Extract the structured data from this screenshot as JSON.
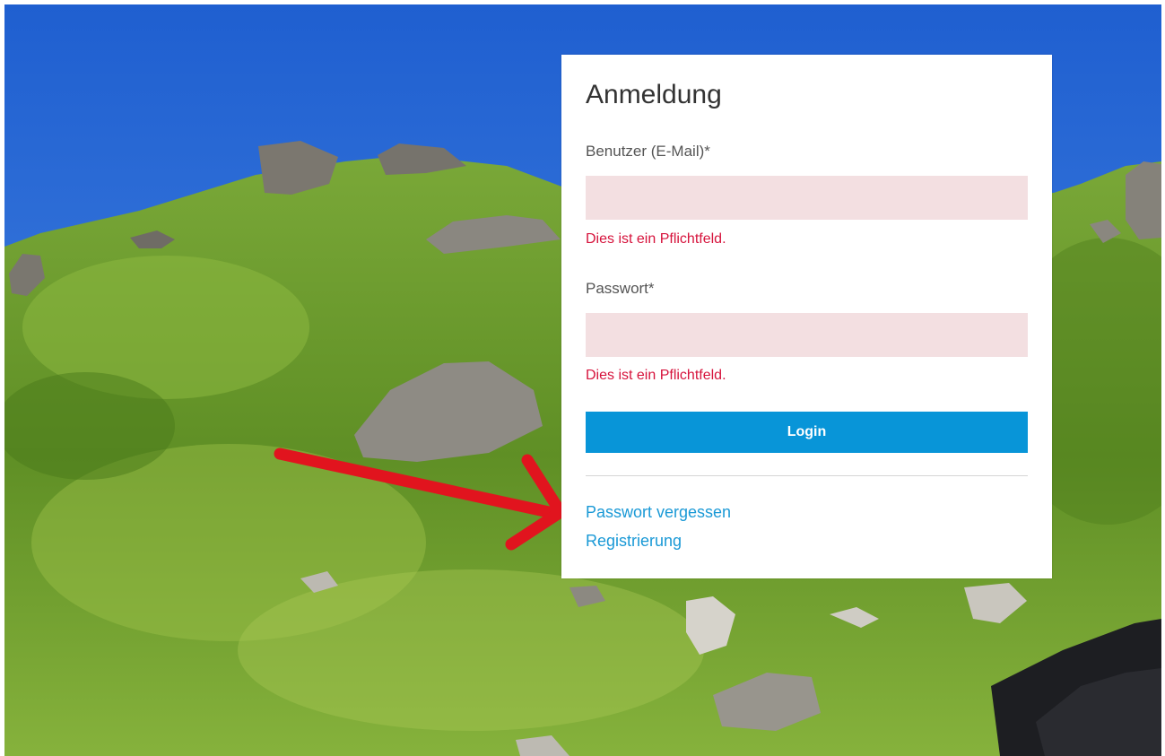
{
  "colors": {
    "sky": "#2d6fd8",
    "grass": "#6a9a2a",
    "input_error_bg": "#f3dfe1",
    "error_text": "#d6133c",
    "button_bg": "#0895d8",
    "link": "#1a99d6",
    "arrow": "#e1141e"
  },
  "login": {
    "title": "Anmeldung",
    "email_label": "Benutzer (E-Mail)*",
    "email_value": "",
    "email_error": "Dies ist ein Pflichtfeld.",
    "password_label": "Passwort*",
    "password_value": "",
    "password_error": "Dies ist ein Pflichtfeld.",
    "submit_label": "Login",
    "forgot_password_link": "Passwort vergessen",
    "register_link": "Registrierung"
  },
  "annotation": {
    "icon": "red-arrow-icon"
  }
}
